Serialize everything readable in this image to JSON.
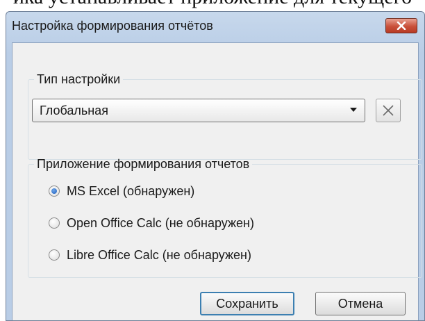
{
  "background_text": "ика устанавливает приложение для текущего",
  "window": {
    "title": "Настройка формирования отчётов",
    "close_icon": "close-icon",
    "title_bar_color": "#c7d8ec",
    "close_color": "#c9503a"
  },
  "settings_type": {
    "label": "Тип настройки",
    "selected": "Глобальная",
    "clear_icon": "x-icon"
  },
  "report_app": {
    "label": "Приложение формирования  отчетов",
    "options": [
      {
        "label": "MS Excel (обнаружен)",
        "checked": true
      },
      {
        "label": "Open Office Calc (не обнаружен)",
        "checked": false
      },
      {
        "label": "Libre Office Calc (не обнаружен)",
        "checked": false
      }
    ]
  },
  "buttons": {
    "save": "Сохранить",
    "cancel": "Отмена"
  }
}
